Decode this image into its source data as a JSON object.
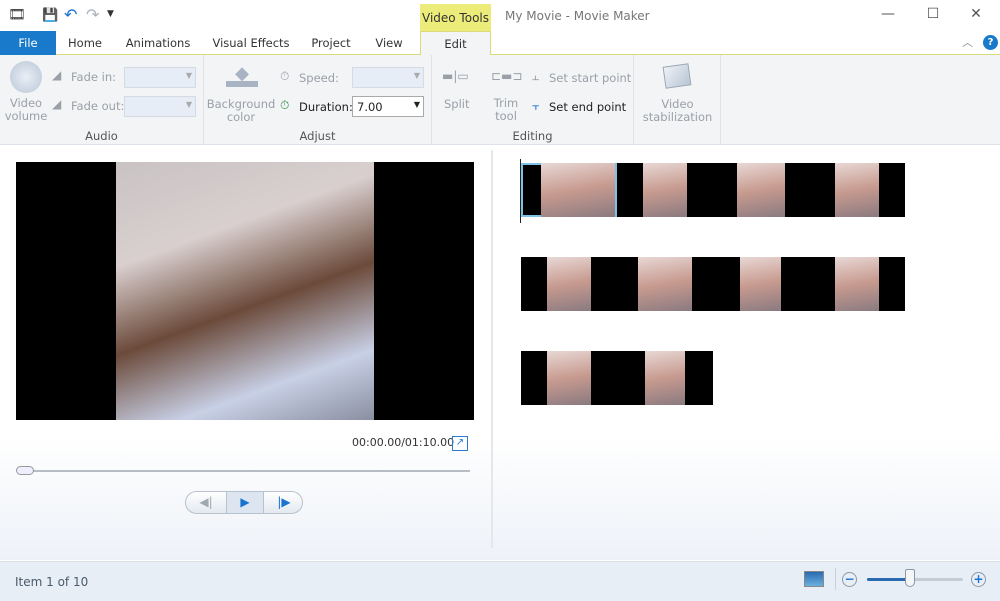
{
  "window": {
    "title": "My Movie - Movie Maker",
    "context_tab": "Video Tools"
  },
  "quick_access": [
    "app-icon",
    "save-icon",
    "undo-icon",
    "redo-icon",
    "customize-icon"
  ],
  "tabs": [
    {
      "label": "File"
    },
    {
      "label": "Home"
    },
    {
      "label": "Animations"
    },
    {
      "label": "Visual Effects"
    },
    {
      "label": "Project"
    },
    {
      "label": "View"
    },
    {
      "label": "Edit"
    }
  ],
  "ribbon": {
    "audio": {
      "label": "Audio",
      "video_volume": "Video volume",
      "fade_in": "Fade in:",
      "fade_out": "Fade out:"
    },
    "adjust": {
      "label": "Adjust",
      "background_color": "Background color",
      "speed": "Speed:",
      "duration": "Duration:",
      "duration_value": "7.00"
    },
    "editing": {
      "label": "Editing",
      "split": "Split",
      "trim_tool": "Trim tool",
      "set_start": "Set start point",
      "set_end": "Set end point"
    },
    "stabilization": {
      "label": "Video stabilization"
    }
  },
  "preview": {
    "time": "00:00.00/01:10.00",
    "seek_position": 0
  },
  "storyboard": {
    "item_count": 10,
    "selected": 1
  },
  "status": {
    "item_text": "Item 1 of 10",
    "zoom_level": 0.45
  },
  "colors": {
    "accent": "#1979ca",
    "context": "#ecec7a",
    "selection": "#7ec3e6"
  }
}
